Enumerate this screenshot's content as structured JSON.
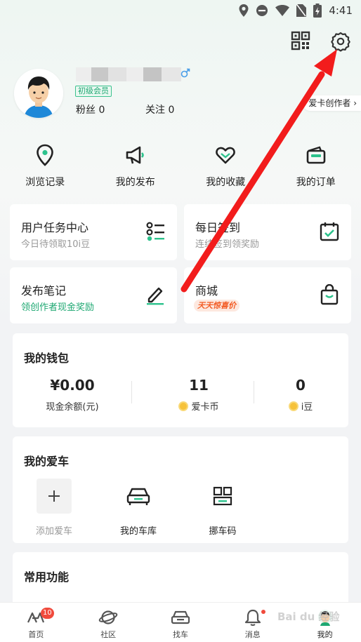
{
  "status_bar": {
    "time": "4:41"
  },
  "profile": {
    "level_badge": "初级会员",
    "fans_label": "粉丝",
    "fans_count": "0",
    "follow_label": "关注",
    "follow_count": "0",
    "creator_tag": "爱卡创作者"
  },
  "quick_actions": [
    {
      "label": "浏览记录",
      "icon": "location-pin-icon"
    },
    {
      "label": "我的发布",
      "icon": "megaphone-icon"
    },
    {
      "label": "我的收藏",
      "icon": "heart-icon"
    },
    {
      "label": "我的订单",
      "icon": "wallet-icon"
    }
  ],
  "tiles": {
    "task_center": {
      "title": "用户任务中心",
      "subtitle": "今日待领取10i豆",
      "icon": "list-icon"
    },
    "daily_checkin": {
      "title": "每日签到",
      "subtitle": "连续签到领奖励",
      "icon": "calendar-check-icon"
    },
    "publish_note": {
      "title": "发布笔记",
      "subtitle": "领创作者现金奖励",
      "icon": "pencil-icon"
    },
    "mall": {
      "title": "商城",
      "promo": "天天惊喜价",
      "icon": "shopping-bag-icon"
    }
  },
  "wallet": {
    "title": "我的钱包",
    "cash_value": "¥0.00",
    "cash_label": "现金余额(元)",
    "coin_value": "11",
    "coin_label": "爱卡币",
    "bean_value": "0",
    "bean_label": "i豆"
  },
  "my_car": {
    "title": "我的爱车",
    "add_label": "添加爱车",
    "garage_label": "我的车库",
    "move_code_label": "挪车码"
  },
  "common": {
    "title": "常用功能"
  },
  "tab_bar": {
    "tabs": [
      {
        "label": "首页",
        "badge": "10"
      },
      {
        "label": "社区"
      },
      {
        "label": "找车"
      },
      {
        "label": "消息"
      },
      {
        "label": "我的"
      }
    ]
  },
  "watermark": "Bai du 经验",
  "colors": {
    "accent": "#1ea872",
    "annotation_arrow": "#f21c1c",
    "badge": "#f04a3c"
  }
}
